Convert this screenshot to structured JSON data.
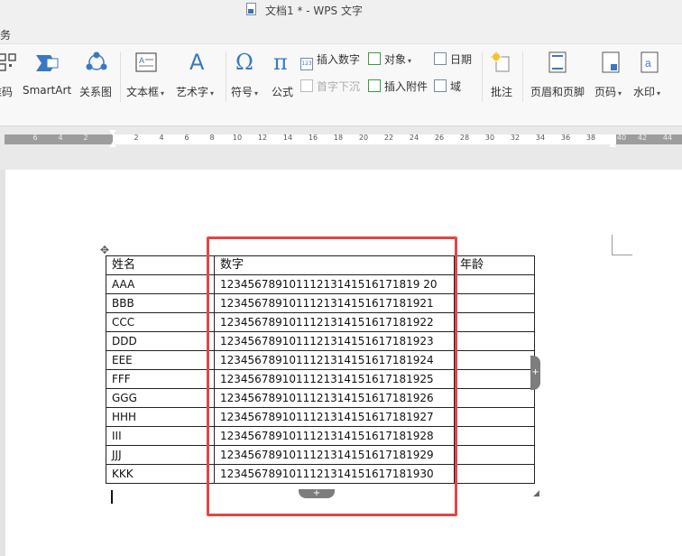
{
  "window": {
    "title": "文档1 * - WPS 文字"
  },
  "menu": {
    "visible_item": "服务"
  },
  "ribbon": {
    "buttons_large": [
      {
        "key": "qrcode",
        "label": "二维码"
      },
      {
        "key": "smartart",
        "label": "SmartArt"
      },
      {
        "key": "relation",
        "label": "关系图"
      },
      {
        "key": "textbox",
        "label": "文本框"
      },
      {
        "key": "wordart",
        "label": "艺术字"
      },
      {
        "key": "symbol",
        "label": "符号"
      },
      {
        "key": "formula",
        "label": "公式"
      },
      {
        "key": "comment",
        "label": "批注"
      },
      {
        "key": "headerfooter",
        "label": "页眉和页脚"
      },
      {
        "key": "pagenum",
        "label": "页码"
      },
      {
        "key": "watermark",
        "label": "水印"
      }
    ],
    "buttons_small": {
      "insert_number": "插入数字",
      "object": "对象",
      "date": "日期",
      "drop_cap": "首字下沉",
      "attachment": "插入附件",
      "field": "域"
    }
  },
  "ruler": {
    "ticks": [
      "6",
      "4",
      "2",
      "2",
      "4",
      "6",
      "8",
      "10",
      "12",
      "14",
      "16",
      "18",
      "20",
      "22",
      "24",
      "26",
      "28",
      "30",
      "32",
      "34",
      "36",
      "38",
      "40",
      "42",
      "44"
    ]
  },
  "table": {
    "headers": [
      "姓名",
      "数字",
      "年龄"
    ],
    "rows": [
      [
        "AAA",
        "12345678910111213141516171819 20",
        ""
      ],
      [
        "BBB",
        "1234567891011121314151617181921",
        ""
      ],
      [
        "CCC",
        "1234567891011121314151617181922",
        ""
      ],
      [
        "DDD",
        "1234567891011121314151617181923",
        ""
      ],
      [
        "EEE",
        "1234567891011121314151617181924",
        ""
      ],
      [
        "FFF",
        "1234567891011121314151617181925",
        ""
      ],
      [
        "GGG",
        "1234567891011121314151617181926",
        ""
      ],
      [
        "HHH",
        "1234567891011121314151617181927",
        ""
      ],
      [
        "III",
        "1234567891011121314151617181928",
        ""
      ],
      [
        "JJJ",
        "1234567891011121314151617181929",
        ""
      ],
      [
        "KKK",
        "1234567891011121314151617181930",
        ""
      ]
    ]
  },
  "colors": {
    "highlight": "#e14545",
    "accent_blue": "#3a78c3"
  },
  "icons": {
    "move_handle": "move-icon",
    "add_row": "plus-icon",
    "add_col": "plus-icon"
  }
}
